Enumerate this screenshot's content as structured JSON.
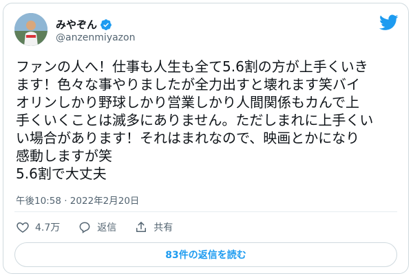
{
  "author": {
    "display_name": "みやぞん",
    "handle": "@anzenmiyazon",
    "verified_icon": "verified-badge-icon",
    "avatar_icon": "avatar-photo"
  },
  "brand": {
    "icon": "twitter-bird-icon",
    "color": "#1d9bf0"
  },
  "tweet": {
    "lines": [
      "ファンの人へ！仕事も人生も全て5.6割の方が上手くいき",
      "ます！色々な事やりましたが全力出すと壊れます笑バイ",
      "オリンしかり野球しかり営業しかり人間関係もカんで上",
      "手くいくことは滅多にありません。ただしまれに上手くい",
      "い場合があります！それはまれなので、映画とかになり",
      "感動しますが笑",
      "5.6割で大丈夫"
    ],
    "time": "午後10:58",
    "separator": "·",
    "date": "2022年2月20日"
  },
  "actions": {
    "like_count": "4.7万",
    "reply_label": "返信",
    "share_label": "共有"
  },
  "replies_button_label": "83件の返信を読む",
  "colors": {
    "text": "#0f1419",
    "secondary": "#536471",
    "border": "#cfd9de",
    "accent": "#1d9bf0"
  }
}
